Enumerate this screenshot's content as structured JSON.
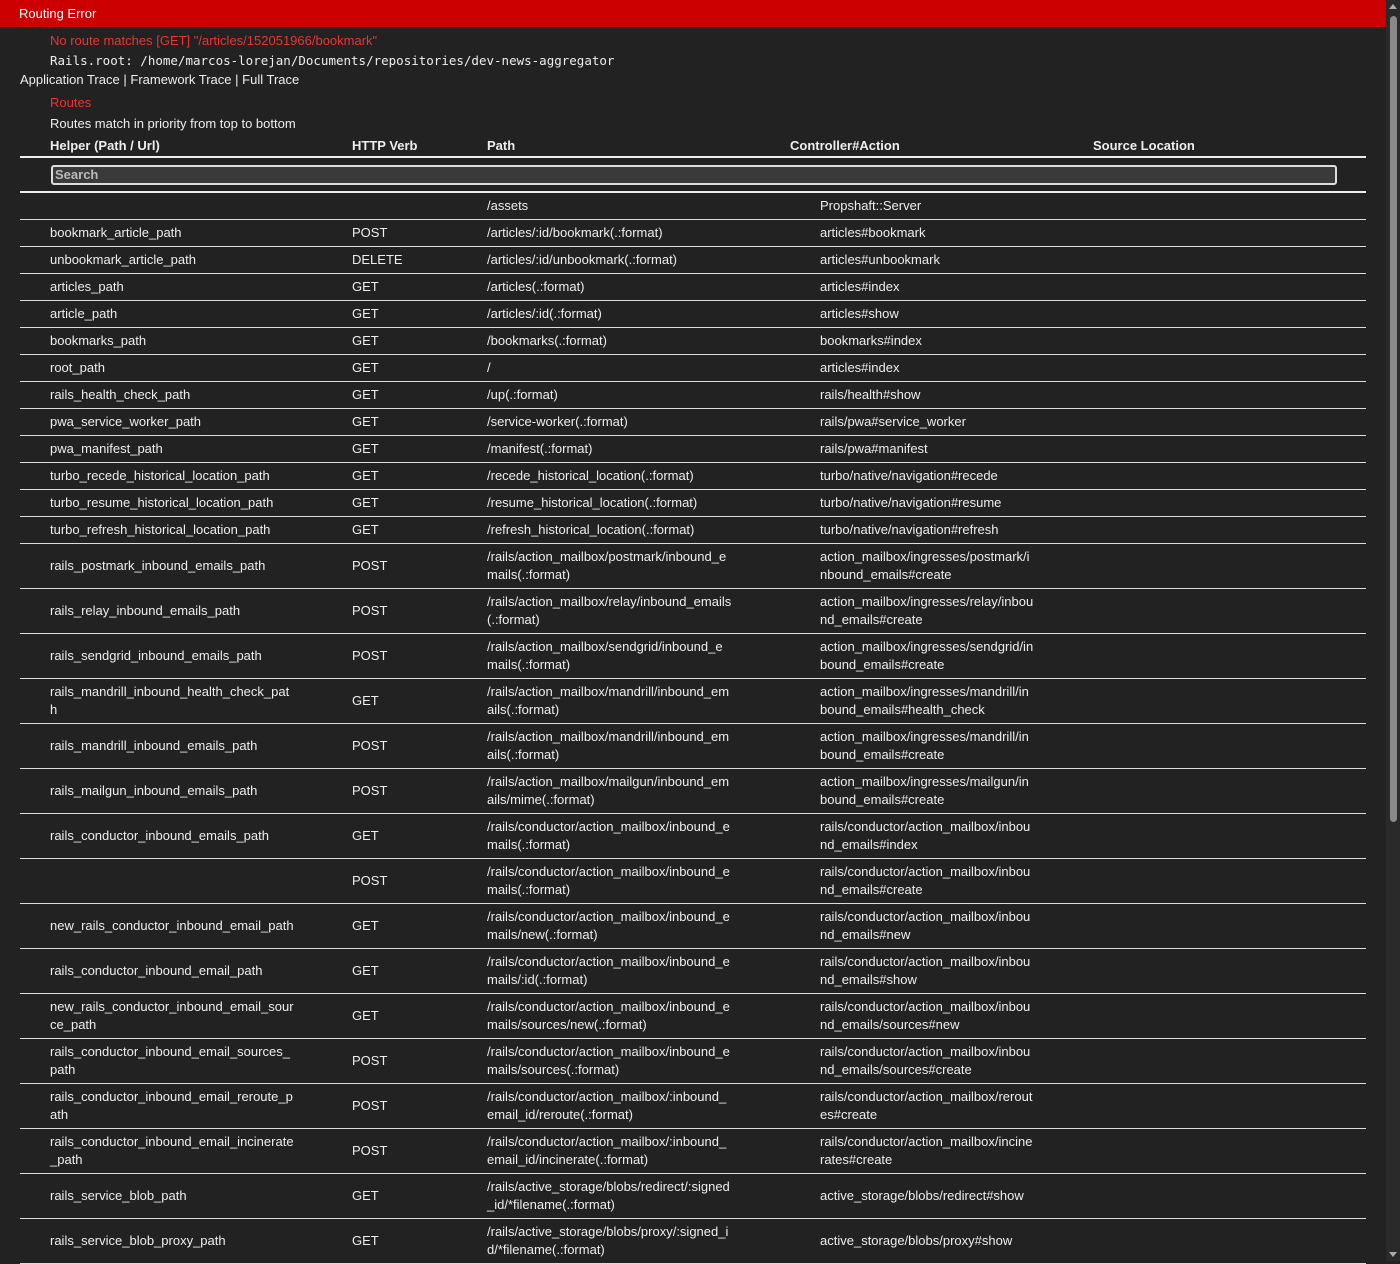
{
  "header": {
    "title": "Routing Error"
  },
  "error": {
    "message": "No route matches [GET] \"/articles/152051966/bookmark\"",
    "rails_root": "Rails.root: /home/marcos-lorejan/Documents/repositories/dev-news-aggregator"
  },
  "traces": {
    "application": "Application Trace",
    "separator": "|",
    "framework": "Framework Trace",
    "full": "Full Trace"
  },
  "routes": {
    "title": "Routes",
    "description": "Routes match in priority from top to bottom",
    "columns": [
      "Helper (Path / Url)",
      "HTTP Verb",
      "Path",
      "Controller#Action",
      "Source Location"
    ],
    "search_placeholder": "Search",
    "rows": [
      {
        "helper": "",
        "verb": "",
        "path": "/assets",
        "action": "Propshaft::Server"
      },
      {
        "helper": "bookmark_article_path",
        "verb": "POST",
        "path": "/articles/:id/bookmark(.:format)",
        "action": "articles#bookmark"
      },
      {
        "helper": "unbookmark_article_path",
        "verb": "DELETE",
        "path": "/articles/:id/unbookmark(.:format)",
        "action": "articles#unbookmark"
      },
      {
        "helper": "articles_path",
        "verb": "GET",
        "path": "/articles(.:format)",
        "action": "articles#index"
      },
      {
        "helper": "article_path",
        "verb": "GET",
        "path": "/articles/:id(.:format)",
        "action": "articles#show"
      },
      {
        "helper": "bookmarks_path",
        "verb": "GET",
        "path": "/bookmarks(.:format)",
        "action": "bookmarks#index"
      },
      {
        "helper": "root_path",
        "verb": "GET",
        "path": "/",
        "action": "articles#index"
      },
      {
        "helper": "rails_health_check_path",
        "verb": "GET",
        "path": "/up(.:format)",
        "action": "rails/health#show"
      },
      {
        "helper": "pwa_service_worker_path",
        "verb": "GET",
        "path": "/service-worker(.:format)",
        "action": "rails/pwa#service_worker"
      },
      {
        "helper": "pwa_manifest_path",
        "verb": "GET",
        "path": "/manifest(.:format)",
        "action": "rails/pwa#manifest"
      },
      {
        "helper": "turbo_recede_historical_location_path",
        "verb": "GET",
        "path": "/recede_historical_location(.:format)",
        "action": "turbo/native/navigation#recede"
      },
      {
        "helper": "turbo_resume_historical_location_path",
        "verb": "GET",
        "path": "/resume_historical_location(.:format)",
        "action": "turbo/native/navigation#resume"
      },
      {
        "helper": "turbo_refresh_historical_location_path",
        "verb": "GET",
        "path": "/refresh_historical_location(.:format)",
        "action": "turbo/native/navigation#refresh"
      },
      {
        "helper": "rails_postmark_inbound_emails_path",
        "verb": "POST",
        "path": "/rails/action_mailbox/postmark/inbound_emails(.:format)",
        "action": "action_mailbox/ingresses/postmark/inbound_emails#create"
      },
      {
        "helper": "rails_relay_inbound_emails_path",
        "verb": "POST",
        "path": "/rails/action_mailbox/relay/inbound_emails(.:format)",
        "action": "action_mailbox/ingresses/relay/inbound_emails#create"
      },
      {
        "helper": "rails_sendgrid_inbound_emails_path",
        "verb": "POST",
        "path": "/rails/action_mailbox/sendgrid/inbound_emails(.:format)",
        "action": "action_mailbox/ingresses/sendgrid/inbound_emails#create"
      },
      {
        "helper": "rails_mandrill_inbound_health_check_path",
        "verb": "GET",
        "path": "/rails/action_mailbox/mandrill/inbound_emails(.:format)",
        "action": "action_mailbox/ingresses/mandrill/inbound_emails#health_check"
      },
      {
        "helper": "rails_mandrill_inbound_emails_path",
        "verb": "POST",
        "path": "/rails/action_mailbox/mandrill/inbound_emails(.:format)",
        "action": "action_mailbox/ingresses/mandrill/inbound_emails#create"
      },
      {
        "helper": "rails_mailgun_inbound_emails_path",
        "verb": "POST",
        "path": "/rails/action_mailbox/mailgun/inbound_emails/mime(.:format)",
        "action": "action_mailbox/ingresses/mailgun/inbound_emails#create"
      },
      {
        "helper": "rails_conductor_inbound_emails_path",
        "verb": "GET",
        "path": "/rails/conductor/action_mailbox/inbound_emails(.:format)",
        "action": "rails/conductor/action_mailbox/inbound_emails#index"
      },
      {
        "helper": "",
        "verb": "POST",
        "path": "/rails/conductor/action_mailbox/inbound_emails(.:format)",
        "action": "rails/conductor/action_mailbox/inbound_emails#create"
      },
      {
        "helper": "new_rails_conductor_inbound_email_path",
        "verb": "GET",
        "path": "/rails/conductor/action_mailbox/inbound_emails/new(.:format)",
        "action": "rails/conductor/action_mailbox/inbound_emails#new"
      },
      {
        "helper": "rails_conductor_inbound_email_path",
        "verb": "GET",
        "path": "/rails/conductor/action_mailbox/inbound_emails/:id(.:format)",
        "action": "rails/conductor/action_mailbox/inbound_emails#show"
      },
      {
        "helper": "new_rails_conductor_inbound_email_source_path",
        "verb": "GET",
        "path": "/rails/conductor/action_mailbox/inbound_emails/sources/new(.:format)",
        "action": "rails/conductor/action_mailbox/inbound_emails/sources#new"
      },
      {
        "helper": "rails_conductor_inbound_email_sources_path",
        "verb": "POST",
        "path": "/rails/conductor/action_mailbox/inbound_emails/sources(.:format)",
        "action": "rails/conductor/action_mailbox/inbound_emails/sources#create"
      },
      {
        "helper": "rails_conductor_inbound_email_reroute_path",
        "verb": "POST",
        "path": "/rails/conductor/action_mailbox/:inbound_email_id/reroute(.:format)",
        "action": "rails/conductor/action_mailbox/reroutes#create"
      },
      {
        "helper": "rails_conductor_inbound_email_incinerate_path",
        "verb": "POST",
        "path": "/rails/conductor/action_mailbox/:inbound_email_id/incinerate(.:format)",
        "action": "rails/conductor/action_mailbox/incinerates#create"
      },
      {
        "helper": "rails_service_blob_path",
        "verb": "GET",
        "path": "/rails/active_storage/blobs/redirect/:signed_id/*filename(.:format)",
        "action": "active_storage/blobs/redirect#show"
      },
      {
        "helper": "rails_service_blob_proxy_path",
        "verb": "GET",
        "path": "/rails/active_storage/blobs/proxy/:signed_id/*filename(.:format)",
        "action": "active_storage/blobs/proxy#show"
      }
    ]
  }
}
